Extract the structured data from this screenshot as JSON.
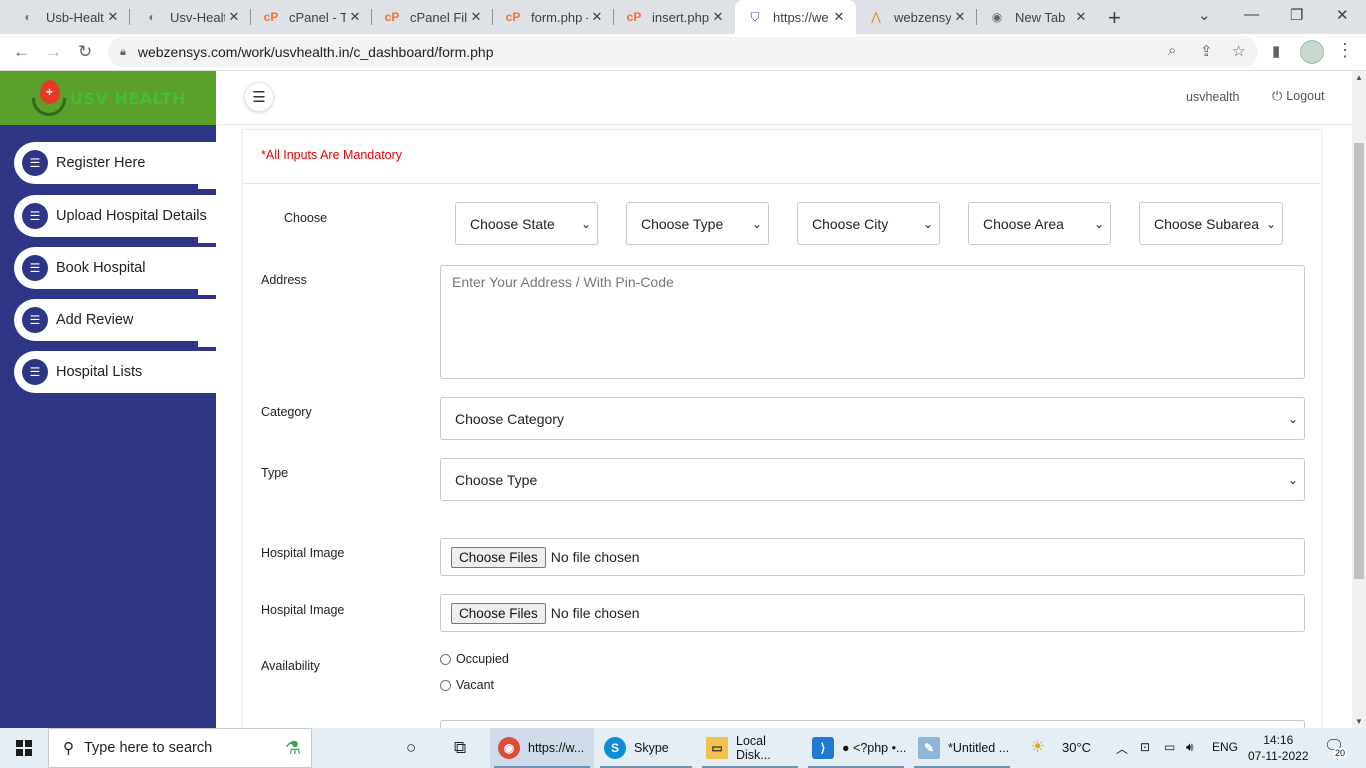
{
  "browser": {
    "tabs": [
      {
        "title": "Usb-Health",
        "favicon": "globe-icon"
      },
      {
        "title": "Usv-Health",
        "favicon": "globe-icon"
      },
      {
        "title": "cPanel - To",
        "favicon": "cpanel-icon"
      },
      {
        "title": "cPanel File",
        "favicon": "cpanel-icon"
      },
      {
        "title": "form.php -",
        "favicon": "cpanel-icon"
      },
      {
        "title": "insert.php",
        "favicon": "cpanel-icon"
      },
      {
        "title": "https://we",
        "favicon": "shield-icon"
      },
      {
        "title": "webzensys",
        "favicon": "webzensys-icon"
      },
      {
        "title": "New Tab",
        "favicon": "chrome-icon"
      }
    ],
    "url": "webzensys.com/work/usvhealth.in/c_dashboard/form.php"
  },
  "app": {
    "brand": "USV HEALTH",
    "sidebar": {
      "items": [
        {
          "label": "Register Here"
        },
        {
          "label": "Upload Hospital Details"
        },
        {
          "label": "Book Hospital"
        },
        {
          "label": "Add Review"
        },
        {
          "label": "Hospital Lists"
        }
      ]
    },
    "header": {
      "username": "usvhealth",
      "logout_label": "Logout"
    }
  },
  "form": {
    "mandatory_note": "*All Inputs Are Mandatory",
    "choose_label": "Choose",
    "choose_selects": [
      "Choose State",
      "Choose Type",
      "Choose City",
      "Choose Area",
      "Choose Subarea"
    ],
    "address_label": "Address",
    "address_placeholder": "Enter Your Address / With Pin-Code",
    "category_label": "Category",
    "category_value": "Choose Category",
    "type_label": "Type",
    "type_value": "Choose Type",
    "image_label_1": "Hospital Image",
    "image_label_2": "Hospital Image",
    "file_button": "Choose Files",
    "file_status": "No file chosen",
    "availability_label": "Availability",
    "availability_options": [
      "Occupied",
      "Vacant"
    ]
  },
  "taskbar": {
    "search_placeholder": "Type here to search",
    "apps": [
      {
        "label": "https://w...",
        "icon": "chrome-icon",
        "active": true
      },
      {
        "label": "Skype",
        "icon": "skype-icon"
      },
      {
        "label": "Local Disk...",
        "icon": "file-explorer-icon"
      },
      {
        "label": "● <?php •...",
        "icon": "vscode-icon"
      },
      {
        "label": "*Untitled ...",
        "icon": "notepad-icon"
      }
    ],
    "weather": "30°C",
    "language": "ENG",
    "time": "14:16",
    "date": "07-11-2022",
    "notifications": "20"
  }
}
